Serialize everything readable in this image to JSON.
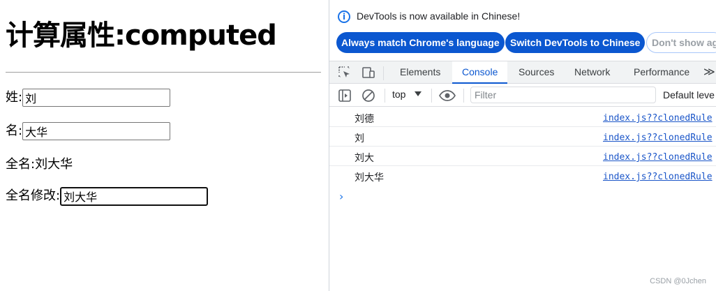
{
  "page": {
    "heading": "计算属性:computed",
    "last_name_label": "姓:",
    "last_name_value": "刘",
    "first_name_label": "名:",
    "first_name_value": "大华",
    "full_name_label": "全名:",
    "full_name_value": "刘大华",
    "edit_label": "全名修改:",
    "edit_value": "刘大华"
  },
  "devtools": {
    "info": {
      "icon": "info-icon",
      "text": "DevTools is now available in Chinese!",
      "match_button": "Always match Chrome's language",
      "switch_button": "Switch DevTools to Chinese",
      "dont_show_button": "Don't show ag"
    },
    "tabs": [
      {
        "label": "Elements",
        "active": false
      },
      {
        "label": "Console",
        "active": true
      },
      {
        "label": "Sources",
        "active": false
      },
      {
        "label": "Network",
        "active": false
      },
      {
        "label": "Performance",
        "active": false
      }
    ],
    "more_tabs": "≫",
    "toolbar": {
      "context": "top",
      "filter_placeholder": "Filter",
      "levels": "Default leve"
    },
    "logs": [
      {
        "message": "刘德",
        "source": "index.js??clonedRule"
      },
      {
        "message": "刘",
        "source": "index.js??clonedRule"
      },
      {
        "message": "刘大",
        "source": "index.js??clonedRule"
      },
      {
        "message": "刘大华",
        "source": "index.js??clonedRule"
      }
    ],
    "prompt": "›",
    "accent_color": "#0b57d0"
  },
  "watermark": "CSDN @0Jchen"
}
